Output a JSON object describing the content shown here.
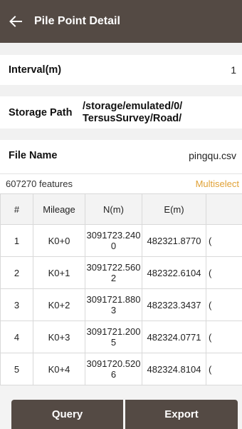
{
  "header": {
    "title": "Pile Point Detail",
    "back_icon": "arrow-left-icon"
  },
  "interval": {
    "label": "Interval(m)",
    "value": "1"
  },
  "storage": {
    "label": "Storage Path",
    "path_line1": "/storage/emulated/0/",
    "path_line2": "TersusSurvey/Road/"
  },
  "file": {
    "label": "File Name",
    "value": "pingqu.csv"
  },
  "features": {
    "count_text": "607270 features",
    "multiselect_label": "Multiselect"
  },
  "table": {
    "columns": [
      "#",
      "Mileage",
      "N(m)",
      "E(m)",
      ""
    ],
    "rows": [
      {
        "index": "1",
        "mileage": "K0+0",
        "n": "3091723.2400",
        "e": "482321.8770",
        "extra": "("
      },
      {
        "index": "2",
        "mileage": "K0+1",
        "n": "3091722.5602",
        "e": "482322.6104",
        "extra": "("
      },
      {
        "index": "3",
        "mileage": "K0+2",
        "n": "3091721.8803",
        "e": "482323.3437",
        "extra": "("
      },
      {
        "index": "4",
        "mileage": "K0+3",
        "n": "3091721.2005",
        "e": "482324.0771",
        "extra": "("
      },
      {
        "index": "5",
        "mileage": "K0+4",
        "n": "3091720.5206",
        "e": "482324.8104",
        "extra": "("
      }
    ]
  },
  "actions": {
    "query_label": "Query",
    "export_label": "Export"
  },
  "colors": {
    "appbar": "#544a44",
    "accent": "#e0a136",
    "gap": "#f1f1f1"
  }
}
